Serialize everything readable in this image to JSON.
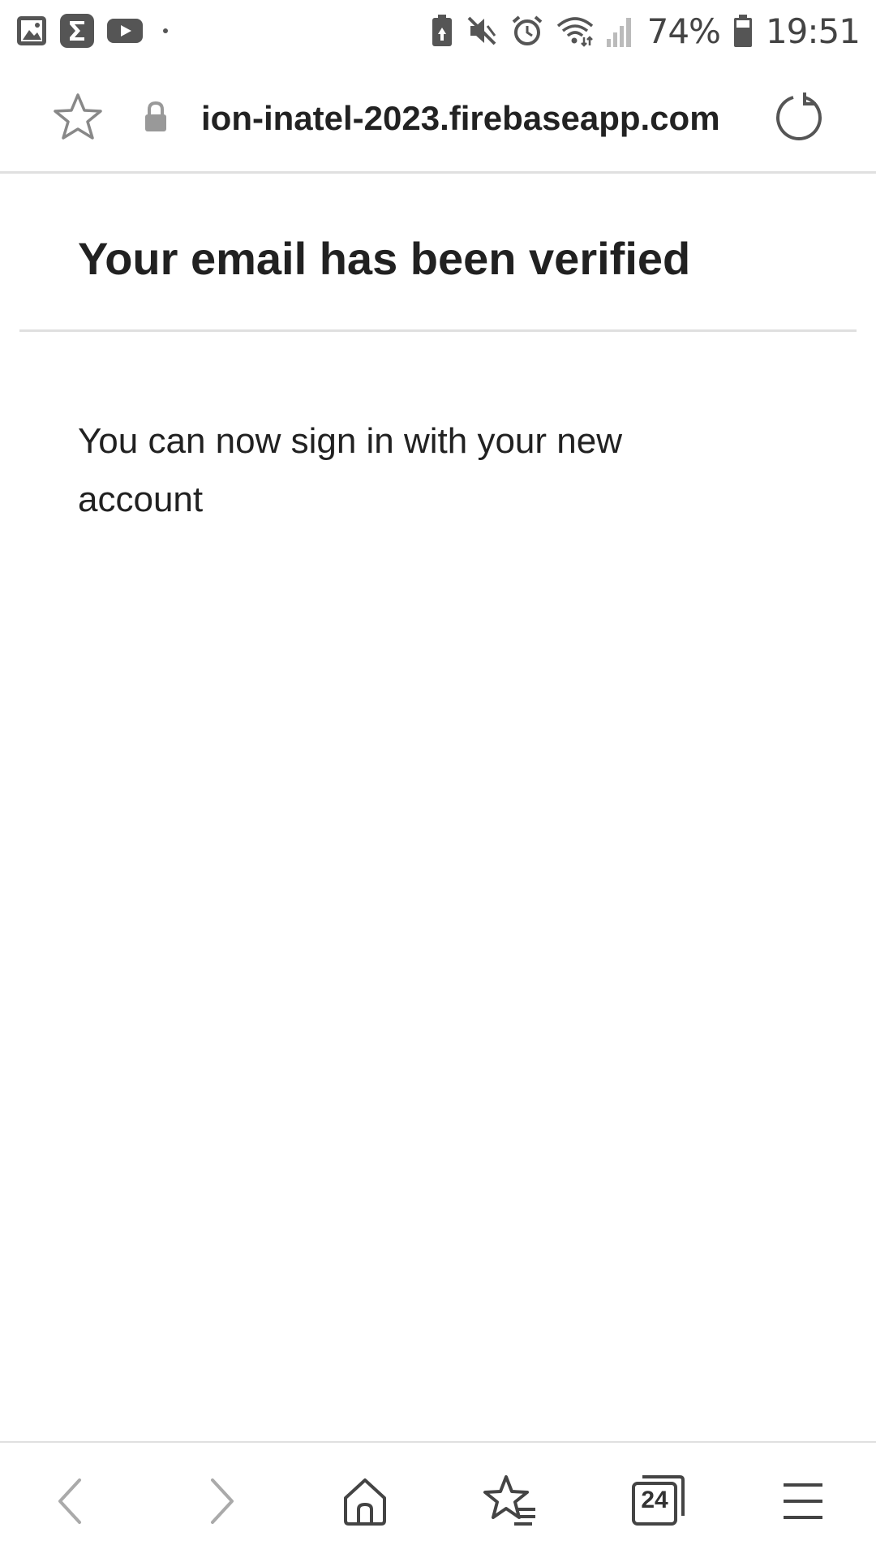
{
  "status_bar": {
    "battery_percent": "74%",
    "time": "19:51",
    "left_icons": [
      "gallery-icon",
      "sigma-icon",
      "youtube-icon",
      "dot-icon"
    ],
    "right_icons": [
      "battery-saver-icon",
      "mute-icon",
      "alarm-icon",
      "wifi-icon",
      "signal-icon",
      "battery-icon"
    ]
  },
  "browser": {
    "url": "ion-inatel-2023.firebaseapp.com",
    "tabs_count": "24"
  },
  "page": {
    "title": "Your email has been verified",
    "message": "You can now sign in with your new account"
  },
  "bottom_nav": {
    "items": [
      "back-icon",
      "forward-icon",
      "home-icon",
      "bookmarks-icon",
      "tabs-icon",
      "menu-icon"
    ]
  }
}
